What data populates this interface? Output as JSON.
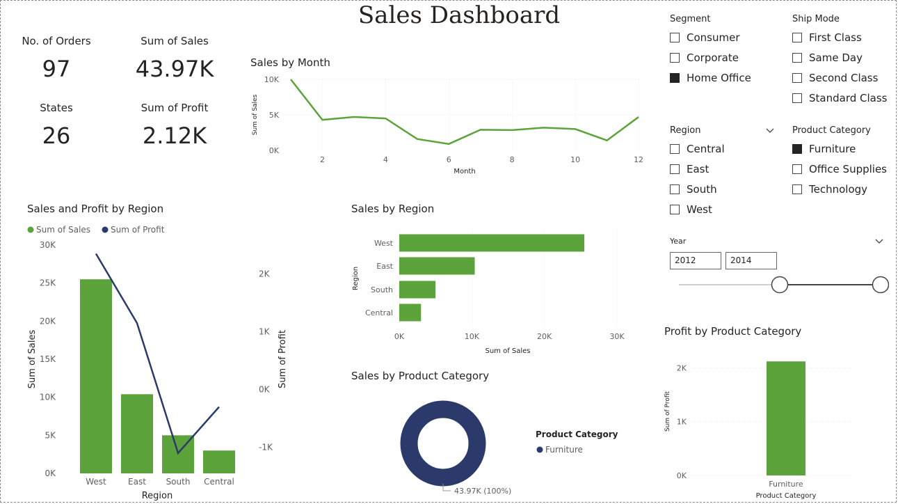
{
  "dashboard": {
    "title": "Sales Dashboard"
  },
  "kpis": [
    {
      "label": "No. of Orders",
      "value": "97"
    },
    {
      "label": "Sum of Sales",
      "value": "43.97K"
    },
    {
      "label": "States",
      "value": "26"
    },
    {
      "label": "Sum of Profit",
      "value": "2.12K"
    }
  ],
  "slicers": {
    "segment": {
      "header": "Segment",
      "items": [
        {
          "label": "Consumer",
          "checked": false
        },
        {
          "label": "Corporate",
          "checked": false
        },
        {
          "label": "Home Office",
          "checked": true
        }
      ]
    },
    "ship_mode": {
      "header": "Ship Mode",
      "items": [
        {
          "label": "First Class",
          "checked": false
        },
        {
          "label": "Same Day",
          "checked": false
        },
        {
          "label": "Second Class",
          "checked": false
        },
        {
          "label": "Standard Class",
          "checked": false
        }
      ]
    },
    "region": {
      "header": "Region",
      "items": [
        {
          "label": "Central",
          "checked": false
        },
        {
          "label": "East",
          "checked": false
        },
        {
          "label": "South",
          "checked": false
        },
        {
          "label": "West",
          "checked": false
        }
      ]
    },
    "product_category": {
      "header": "Product Category",
      "items": [
        {
          "label": "Furniture",
          "checked": true
        },
        {
          "label": "Office Supplies",
          "checked": false
        },
        {
          "label": "Technology",
          "checked": false
        }
      ]
    },
    "year": {
      "header": "Year",
      "from": "2012",
      "to": "2014",
      "min": 2010,
      "max": 2014
    }
  },
  "colors": {
    "green": "#5BA33A",
    "navy": "#2B3A6B",
    "text": "#252423",
    "axis": "#605E5C"
  },
  "chart_data": [
    {
      "id": "sales-by-month",
      "type": "line",
      "title": "Sales by Month",
      "xlabel": "Month",
      "ylabel": "Sum of Sales",
      "x": [
        1,
        2,
        3,
        4,
        5,
        6,
        7,
        8,
        9,
        10,
        11,
        12
      ],
      "values": [
        10000,
        4300,
        4700,
        4500,
        1600,
        900,
        2900,
        2850,
        3200,
        3000,
        1400,
        4700
      ],
      "xticks": [
        2,
        4,
        6,
        8,
        10,
        12
      ],
      "yticks": [
        0,
        5000,
        10000
      ],
      "ytick_labels": [
        "0K",
        "5K",
        "10K"
      ],
      "ylim": [
        0,
        10000
      ],
      "grid": true
    },
    {
      "id": "sales-profit-by-region",
      "type": "bar",
      "title": "Sales and Profit by Region",
      "xlabel": "Region",
      "ylabel": "Sum of Sales",
      "y2label": "Sum of Profit",
      "categories": [
        "West",
        "East",
        "South",
        "Central"
      ],
      "series": [
        {
          "name": "Sum of Sales",
          "type": "bar",
          "values": [
            25500,
            10400,
            5000,
            3000
          ]
        },
        {
          "name": "Sum of Profit",
          "type": "line",
          "values": [
            2350,
            1150,
            -1100,
            -300
          ]
        }
      ],
      "legend": "top-left",
      "ylim": [
        0,
        30000
      ],
      "yticks": [
        0,
        5000,
        10000,
        15000,
        20000,
        25000,
        30000
      ],
      "ytick_labels": [
        "0K",
        "5K",
        "10K",
        "15K",
        "20K",
        "25K",
        "30K"
      ],
      "y2lim": [
        -1450,
        2500
      ],
      "y2ticks": [
        -1000,
        0,
        1000,
        2000
      ],
      "y2tick_labels": [
        "-1K",
        "0K",
        "1K",
        "2K"
      ]
    },
    {
      "id": "sales-by-region",
      "type": "bar",
      "orientation": "horizontal",
      "title": "Sales by Region",
      "xlabel": "Sum of Sales",
      "ylabel": "Region",
      "categories": [
        "West",
        "East",
        "South",
        "Central"
      ],
      "values": [
        25500,
        10400,
        5000,
        3000
      ],
      "xlim": [
        0,
        30000
      ],
      "xticks": [
        0,
        10000,
        20000,
        30000
      ],
      "xtick_labels": [
        "0K",
        "10K",
        "20K",
        "30K"
      ]
    },
    {
      "id": "sales-by-product-category",
      "type": "pie",
      "title": "Sales by Product Category",
      "legend_title": "Product Category",
      "categories": [
        "Furniture"
      ],
      "values": [
        43970
      ],
      "data_labels": [
        "43.97K (100%)"
      ]
    },
    {
      "id": "profit-by-product-category",
      "type": "bar",
      "title": "Profit by Product Category",
      "xlabel": "Product Category",
      "ylabel": "Sum of Profit",
      "categories": [
        "Furniture"
      ],
      "values": [
        2120
      ],
      "ylim": [
        0,
        2200
      ],
      "yticks": [
        0,
        1000,
        2000
      ],
      "ytick_labels": [
        "0K",
        "1K",
        "2K"
      ]
    }
  ]
}
